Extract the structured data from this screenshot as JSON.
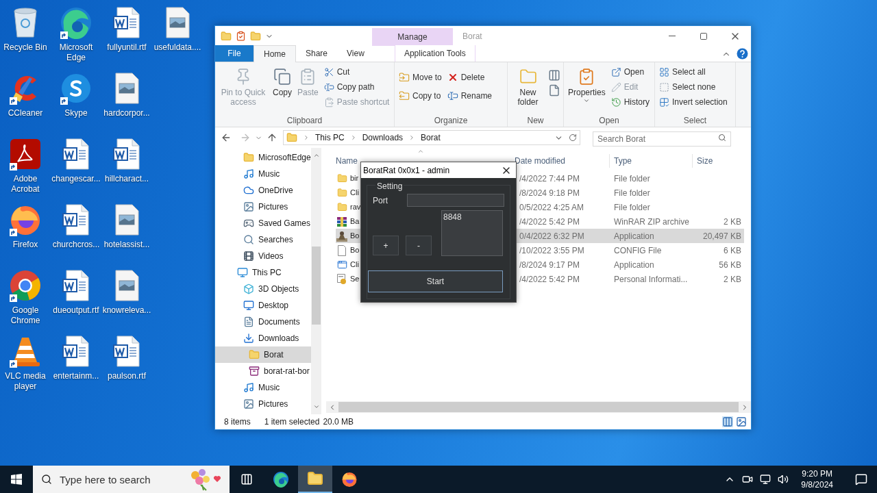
{
  "desktop": {
    "icons": [
      {
        "label": "Recycle Bin",
        "kind": "recycle",
        "shortcut": false
      },
      {
        "label": "CCleaner",
        "kind": "ccleaner",
        "shortcut": true
      },
      {
        "label": "Adobe Acrobat",
        "kind": "acrobat",
        "shortcut": true
      },
      {
        "label": "Firefox",
        "kind": "firefox",
        "shortcut": true
      },
      {
        "label": "Google Chrome",
        "kind": "chrome",
        "shortcut": true
      },
      {
        "label": "VLC media player",
        "kind": "vlc",
        "shortcut": true
      },
      {
        "label": "Microsoft Edge",
        "kind": "edge",
        "shortcut": true
      },
      {
        "label": "Skype",
        "kind": "skype",
        "shortcut": true
      },
      {
        "label": "changescar...",
        "kind": "word",
        "shortcut": false
      },
      {
        "label": "churchcros...",
        "kind": "word",
        "shortcut": false
      },
      {
        "label": "dueoutput.rtf",
        "kind": "word",
        "shortcut": false
      },
      {
        "label": "entertainm...",
        "kind": "word",
        "shortcut": false
      },
      {
        "label": "fullyuntil.rtf",
        "kind": "word",
        "shortcut": false
      },
      {
        "label": "hardcorpor...",
        "kind": "image",
        "shortcut": false
      },
      {
        "label": "hillcharact...",
        "kind": "word",
        "shortcut": false
      },
      {
        "label": "hotelassist...",
        "kind": "image",
        "shortcut": false
      },
      {
        "label": "knowreleva...",
        "kind": "image",
        "shortcut": false
      },
      {
        "label": "paulson.rtf",
        "kind": "word",
        "shortcut": false
      },
      {
        "label": "usefuldata....",
        "kind": "image",
        "shortcut": false
      }
    ]
  },
  "explorer": {
    "title": "Borat",
    "context_tab": {
      "group": "Manage",
      "label": "Application Tools"
    },
    "tabs": [
      {
        "label": "File",
        "kind": "file",
        "selected": false
      },
      {
        "label": "Home",
        "kind": "tab",
        "selected": true
      },
      {
        "label": "Share",
        "kind": "tab",
        "selected": false
      },
      {
        "label": "View",
        "kind": "tab",
        "selected": false
      }
    ],
    "ribbon": [
      {
        "label": "Clipboard",
        "items": [
          {
            "label": "Pin to Quick access",
            "kind": "large",
            "disabled": true
          },
          {
            "label": "Copy",
            "kind": "large",
            "disabled": false
          },
          {
            "label": "Paste",
            "kind": "large",
            "disabled": true
          },
          {
            "label": "Cut",
            "kind": "small",
            "disabled": false
          },
          {
            "label": "Copy path",
            "kind": "small",
            "disabled": false
          },
          {
            "label": "Paste shortcut",
            "kind": "small",
            "disabled": true
          }
        ]
      },
      {
        "label": "Organize",
        "items": [
          {
            "label": "Move to",
            "kind": "small",
            "disabled": false
          },
          {
            "label": "Copy to",
            "kind": "small",
            "disabled": false
          },
          {
            "label": "Delete",
            "kind": "small",
            "disabled": false
          },
          {
            "label": "Rename",
            "kind": "small",
            "disabled": false
          }
        ]
      },
      {
        "label": "New",
        "items": [
          {
            "label": "New folder",
            "kind": "large",
            "disabled": false
          }
        ]
      },
      {
        "label": "Open",
        "items": [
          {
            "label": "Properties",
            "kind": "large",
            "disabled": false
          },
          {
            "label": "Open",
            "kind": "small",
            "disabled": false
          },
          {
            "label": "Edit",
            "kind": "small",
            "disabled": true
          },
          {
            "label": "History",
            "kind": "small",
            "disabled": false
          }
        ]
      },
      {
        "label": "Select",
        "items": [
          {
            "label": "Select all",
            "kind": "small",
            "disabled": false
          },
          {
            "label": "Select none",
            "kind": "small",
            "disabled": false
          },
          {
            "label": "Invert selection",
            "kind": "small",
            "disabled": false
          }
        ]
      }
    ],
    "breadcrumbs": [
      "This PC",
      "Downloads",
      "Borat"
    ],
    "search": {
      "placeholder": "Search Borat"
    },
    "nav_pane": {
      "partial_group": [
        {
          "label": "MicrosoftEdge",
          "kind": "folder",
          "selected": false
        },
        {
          "label": "Music",
          "kind": "music",
          "selected": false
        },
        {
          "label": "OneDrive",
          "kind": "cloud",
          "selected": false
        },
        {
          "label": "Pictures",
          "kind": "pictures",
          "selected": false
        },
        {
          "label": "Saved Games",
          "kind": "games",
          "selected": false
        },
        {
          "label": "Searches",
          "kind": "search",
          "selected": false
        },
        {
          "label": "Videos",
          "kind": "videos",
          "selected": false
        }
      ],
      "tree": [
        {
          "label": "This PC",
          "kind": "pc",
          "selected": false,
          "children": [
            {
              "label": "3D Objects",
              "kind": "cube",
              "selected": false
            },
            {
              "label": "Desktop",
              "kind": "desktop",
              "selected": false
            },
            {
              "label": "Documents",
              "kind": "documents",
              "selected": false
            },
            {
              "label": "Downloads",
              "kind": "downloads",
              "selected": false,
              "children": [
                {
                  "label": "Borat",
                  "kind": "folder",
                  "selected": true
                },
                {
                  "label": "borat-rat-bor",
                  "kind": "zip",
                  "selected": false
                }
              ]
            },
            {
              "label": "Music",
              "kind": "music",
              "selected": false
            },
            {
              "label": "Pictures",
              "kind": "pictures",
              "selected": false
            }
          ]
        }
      ]
    },
    "columns": [
      "Name",
      "Date modified",
      "Type",
      "Size"
    ],
    "rows": [
      {
        "name": "bir",
        "date": "/4/2022 7:44 PM",
        "type": "File folder",
        "size": "",
        "kind": "folder",
        "selected": false
      },
      {
        "name": "Cli",
        "date": "/8/2024 9:18 PM",
        "type": "File folder",
        "size": "",
        "kind": "folder",
        "selected": false
      },
      {
        "name": "rav",
        "date": "0/5/2022 4:25 AM",
        "type": "File folder",
        "size": "",
        "kind": "folder",
        "selected": false
      },
      {
        "name": "Ba",
        "date": "/4/2022 5:42 PM",
        "type": "WinRAR ZIP archive",
        "size": "2 KB",
        "kind": "zip",
        "selected": false
      },
      {
        "name": "Bo",
        "date": "0/4/2022 6:32 PM",
        "type": "Application",
        "size": "20,497 KB",
        "kind": "app",
        "selected": true
      },
      {
        "name": "Bo",
        "date": "/10/2022 3:55 PM",
        "type": "CONFIG File",
        "size": "6 KB",
        "kind": "config",
        "selected": false
      },
      {
        "name": "Cli",
        "date": "/8/2024 9:17 PM",
        "type": "Application",
        "size": "56 KB",
        "kind": "window",
        "selected": false
      },
      {
        "name": "Se",
        "date": "/4/2022 5:42 PM",
        "type": "Personal Informati...",
        "size": "2 KB",
        "kind": "cert",
        "selected": false
      }
    ],
    "status": {
      "count": "8 items",
      "selection": "1 item selected",
      "size": "20.0 MB"
    }
  },
  "dialog": {
    "title": "BoratRat 0x0x1 - admin",
    "group": "Setting",
    "port_label": "Port",
    "ports": [
      "8848"
    ],
    "add": "+",
    "remove": "-",
    "start": "Start"
  },
  "taskbar": {
    "search_placeholder": "Type here to search",
    "apps": [
      {
        "kind": "taskview",
        "selected": false
      },
      {
        "kind": "edge",
        "selected": false
      },
      {
        "kind": "explorer",
        "selected": true
      },
      {
        "kind": "firefox",
        "selected": false
      }
    ],
    "time": "9:20 PM",
    "date": "9/8/2024"
  }
}
